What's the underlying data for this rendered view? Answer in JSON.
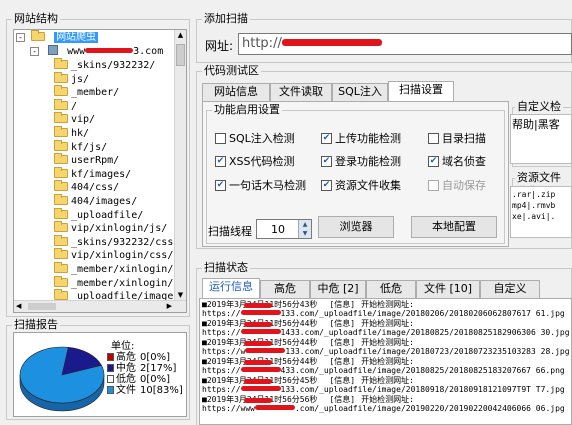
{
  "site_structure": {
    "title": "网站结构",
    "root_label": "网站爬虫",
    "host_prefix": "www",
    "host_suffix": "3.com",
    "items": [
      "_skins/932232/",
      "js/",
      "_member/",
      "/",
      "vip/",
      "hk/",
      "kf/js/",
      "userRpm/",
      "kf/images/",
      "404/css/",
      "404/images/",
      "_uploadfile/",
      "vip/xinlogin/js/",
      "_skins/932232/css/",
      "vip/xinlogin/css/",
      "_member/xinlogin/j",
      "_member/xinlogin/c",
      "_uploadfile/image/",
      "_uploadfile/image/",
      "_member/xinlogin/j"
    ]
  },
  "scan_report": {
    "title": "扫描报告",
    "unit_label": "单位:",
    "legend": [
      {
        "label": "高危",
        "value": "0[0%]",
        "color": "#c00000",
        "fraction": 0
      },
      {
        "label": "中危",
        "value": "2[17%]",
        "color": "#1a1a8c",
        "fraction": 0.17
      },
      {
        "label": "低危",
        "value": "0[0%]",
        "color": "#ffffff",
        "fraction": 0
      },
      {
        "label": "文件",
        "value": "10[83%]",
        "color": "#1e90e0",
        "fraction": 0.83
      }
    ]
  },
  "add_scan": {
    "title": "添加扫描",
    "url_label": "网址:",
    "url_value": "http://"
  },
  "code_test": {
    "title": "代码测试区",
    "tabs": [
      "网站信息",
      "文件读取",
      "SQL注入",
      "扫描设置"
    ],
    "active_tab": 3,
    "settings_title": "功能启用设置",
    "options": [
      {
        "label": "SQL注入检测",
        "checked": false,
        "enabled": true
      },
      {
        "label": "上传功能检测",
        "checked": true,
        "enabled": true
      },
      {
        "label": "目录扫描",
        "checked": false,
        "enabled": true
      },
      {
        "label": "XSS代码检测",
        "checked": true,
        "enabled": true
      },
      {
        "label": "登录功能检测",
        "checked": true,
        "enabled": true
      },
      {
        "label": "域名侦查",
        "checked": true,
        "enabled": true
      },
      {
        "label": "一句话木马检测",
        "checked": true,
        "enabled": true
      },
      {
        "label": "资源文件收集",
        "checked": true,
        "enabled": true
      },
      {
        "label": "自动保存",
        "checked": false,
        "enabled": false
      }
    ],
    "threads_label": "扫描线程",
    "threads_value": "10",
    "browser_button": "浏览器",
    "local_config_button": "本地配置",
    "custom_check": {
      "title": "自定义检",
      "text": "帮助|黑客"
    },
    "resource_collect": {
      "title": "资源文件收集",
      "lines": [
        ".rar|.zip",
        "mp4|.rmvb",
        "xe|.avi|."
      ]
    }
  },
  "scan_status": {
    "title": "扫描状态",
    "tabs": [
      "运行信息",
      "高危",
      "中危 [2]",
      "低危",
      "文件 [10]",
      "自定义"
    ],
    "active_tab": 0,
    "log": [
      {
        "time": "■2019年3月24日11时56分43秒",
        "tag": "[信息]",
        "msg": "开始检测网址:",
        "url_head": "https://",
        "url_tail": "133.com/_uploadfile/image/20180206/20180206062807617 61.jpg"
      },
      {
        "time": "■2019年3月24日11时56分44秒",
        "tag": "[信息]",
        "msg": "开始检测网址:",
        "url_head": "https://",
        "url_tail": "1433.com/_uploadfile/image/20180825/20180825182906306 30.jpg"
      },
      {
        "time": "■2019年3月24日11时56分44秒",
        "tag": "[信息]",
        "msg": "开始检测网址:",
        "url_head": "https://w",
        "url_tail": "133.com/_uploadfile/image/20180723/20180723235103283 28.jpg"
      },
      {
        "time": "■2019年3月24日11时56分44秒",
        "tag": "[信息]",
        "msg": "开始检测网址:",
        "url_head": "https://",
        "url_tail": "433.com/_uploadfile/image/20180825/20180825183207667 66.png"
      },
      {
        "time": "■2019年3月24日11时56分45秒",
        "tag": "[信息]",
        "msg": "开始检测网址:",
        "url_head": "https://",
        "url_tail": "133.com/_uploadfile/image/20180918/20180918121097T9T T7.jpg"
      },
      {
        "time": "■2019年3月24日11时56分56秒",
        "tag": "[信息]",
        "msg": "开始检测网址:",
        "url_head": "https://www",
        "url_tail": ".com/_uploadfile/image/20190220/20190220042406066 06.jpg"
      }
    ]
  }
}
